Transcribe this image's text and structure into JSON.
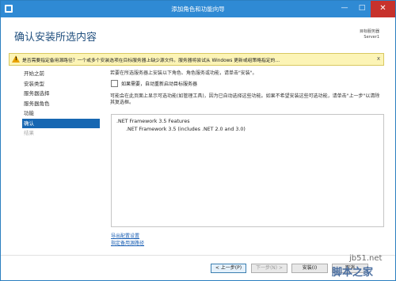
{
  "window": {
    "title": "添加角色和功能向导",
    "minimize_glyph": "—",
    "maximize_glyph": "□",
    "close_glyph": "✕"
  },
  "header": {
    "page_title": "确认安装所选内容",
    "target_label": "目标服务器",
    "target_server": "Server1"
  },
  "warning": {
    "icon_glyph": "!",
    "text": "是否需要指定备用源路径？一个或多个安装选项在目标服务器上缺少源文件。服务器将尝试从 Windows 更新或组策略指定的…",
    "close_glyph": "x"
  },
  "nav": {
    "items": [
      {
        "label": "开始之前",
        "state": "normal"
      },
      {
        "label": "安装类型",
        "state": "normal"
      },
      {
        "label": "服务器选择",
        "state": "normal"
      },
      {
        "label": "服务器角色",
        "state": "normal"
      },
      {
        "label": "功能",
        "state": "normal"
      },
      {
        "label": "确认",
        "state": "active"
      },
      {
        "label": "结果",
        "state": "disabled"
      }
    ]
  },
  "main": {
    "description1": "若要在所选服务器上安装以下角色、角色服务或功能，请单击\"安装\"。",
    "restart_checkbox_label": "如果需要，自动重新启动目标服务器",
    "restart_checked": false,
    "description2": "可能会在此页面上显示可选功能(如管理工具)，因为已自动选择这些功能。如果不希望安装这些可选功能，请单击\"上一步\"以清除其复选框。",
    "feature_title": ".NET Framework 3.5 Features",
    "feature_sub": ".NET Framework 3.5 (includes .NET 2.0 and 3.0)",
    "link_export": "导出配置设置",
    "link_source": "指定备用源路径"
  },
  "footer": {
    "prev": "< 上一步(P)",
    "next": "下一步(N) >",
    "install": "安装(I)",
    "cancel": "取消"
  },
  "watermark": {
    "line1": "jb51.net",
    "line2": "脚本之家"
  },
  "colors": {
    "titlebar": "#2f8ad4",
    "close_button": "#c7322c",
    "nav_active": "#1767b2",
    "warning_bg": "#fcf4b6",
    "link": "#1a5fb4"
  }
}
